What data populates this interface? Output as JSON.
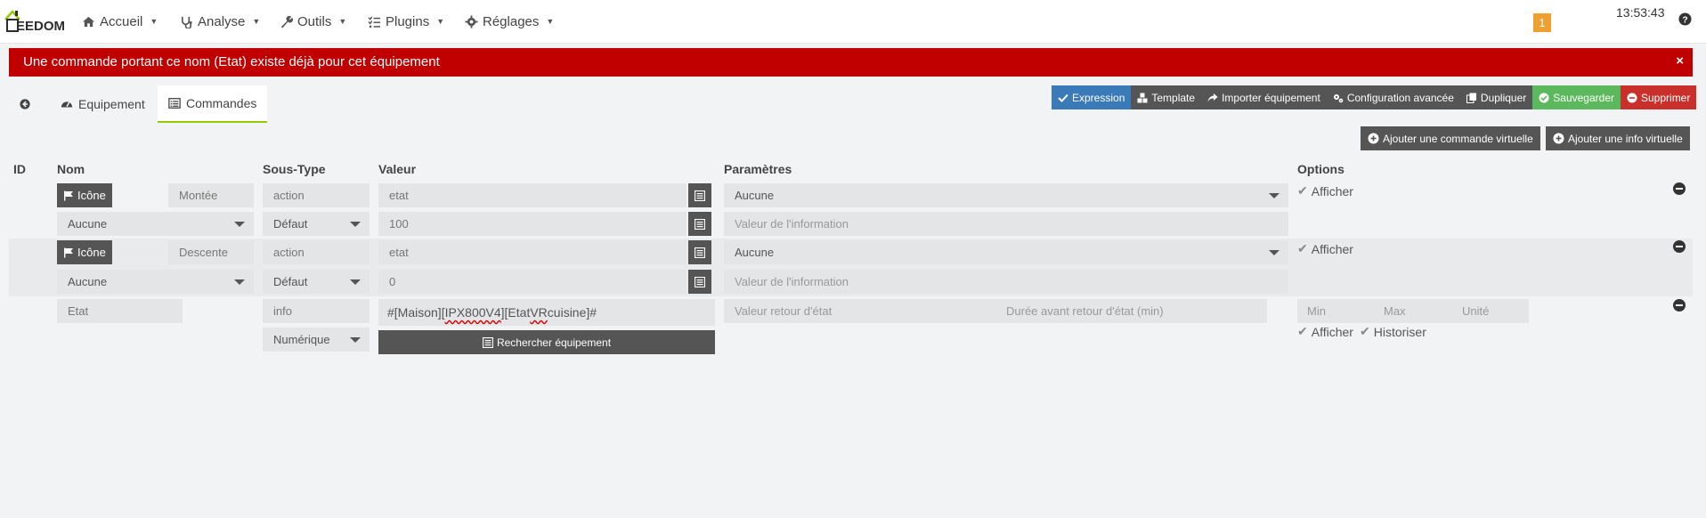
{
  "nav": {
    "logo": {
      "initial": "J",
      "text": "EEDOM"
    },
    "menus": [
      {
        "label": "Accueil",
        "icon": "home-icon"
      },
      {
        "label": "Analyse",
        "icon": "stethoscope-icon"
      },
      {
        "label": "Outils",
        "icon": "wrench-icon"
      },
      {
        "label": "Plugins",
        "icon": "tasks-icon"
      },
      {
        "label": "Réglages",
        "icon": "gear-icon"
      }
    ],
    "badge": "1",
    "clock": "13:53:43"
  },
  "alert": {
    "message": "Une commande portant ce nom (Etat) existe déjà pour cet équipement",
    "close": "×"
  },
  "tabs": [
    {
      "label": "",
      "icon": "back-arrow-icon"
    },
    {
      "label": "Equipement",
      "icon": "tachometer-icon"
    },
    {
      "label": "Commandes",
      "icon": "list-icon",
      "active": true
    }
  ],
  "actions": [
    {
      "label": "Expression",
      "icon": "check-icon",
      "color": "#3a7ab8"
    },
    {
      "label": "Template",
      "icon": "cubes-icon",
      "color": "#555555"
    },
    {
      "label": "Importer équipement",
      "icon": "share-icon",
      "color": "#555555"
    },
    {
      "label": "Configuration avancée",
      "icon": "cogs-icon",
      "color": "#555555"
    },
    {
      "label": "Dupliquer",
      "icon": "copy-icon",
      "color": "#555555"
    },
    {
      "label": "Sauvegarder",
      "icon": "check-circle-icon",
      "color": "#5cb85c"
    },
    {
      "label": "Supprimer",
      "icon": "minus-circle-icon",
      "color": "#c9302c"
    }
  ],
  "add_buttons": {
    "command": "Ajouter une commande virtuelle",
    "info": "Ajouter une info virtuelle"
  },
  "columns": {
    "id": "ID",
    "nom": "Nom",
    "sous_type": "Sous-Type",
    "valeur": "Valeur",
    "parametres": "Paramètres",
    "options": "Options"
  },
  "commands": [
    {
      "icon_button": "Icône",
      "name": "Montée",
      "type": "action",
      "value": "etat",
      "param": "Aucune",
      "row2_select": "Aucune",
      "subtype": "Défaut",
      "value2": "100",
      "info_placeholder": "Valeur de l'information",
      "option": "Afficher"
    },
    {
      "icon_button": "Icône",
      "name": "Descente",
      "type": "action",
      "value": "etat",
      "param": "Aucune",
      "row2_select": "Aucune",
      "subtype": "Défaut",
      "value2": "0",
      "info_placeholder": "Valeur de l'information",
      "option": "Afficher"
    }
  ],
  "info_command": {
    "name": "Etat",
    "type": "info",
    "subtype": "Numérique",
    "value_parts": [
      "#[Maison][",
      "IPX800V4",
      "][Etat ",
      "VR",
      " cuisine]#"
    ],
    "search_button": "Rechercher équipement",
    "return_state_placeholder": "Valeur retour d'état",
    "return_delay_placeholder": "Durée avant retour d'état (min)",
    "min": "Min",
    "max": "Max",
    "unit": "Unité",
    "opt_afficher": "Afficher",
    "opt_historiser": "Historiser"
  }
}
